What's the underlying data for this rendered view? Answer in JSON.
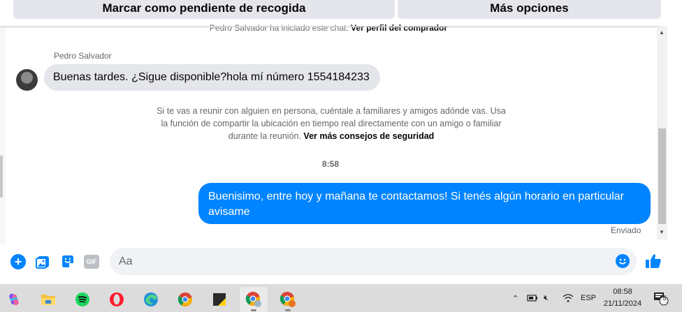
{
  "actions": {
    "mark_pending": "Marcar como pendiente de recogida",
    "more_options": "Más opciones"
  },
  "system": {
    "started_text": "Pedro Salvador ha iniciado este chat.",
    "profile_link": "Ver perfil del comprador"
  },
  "conversation": {
    "sender_name": "Pedro Salvador",
    "incoming_message": "Buenas tardes. ¿Sigue disponible?hola mí número 1554184233",
    "safety_text": "Si te vas a reunir con alguien en persona, cuéntale a familiares y amigos adónde vas. Usa la función de compartir la ubicación en tiempo real directamente con un amigo o familiar durante la reunión.",
    "safety_link": "Ver más consejos de seguridad",
    "time": "8:58",
    "outgoing_message": "Buenisimo, entre hoy y mañana te contactamos! Si tenés algún horario en particular avisame",
    "status": "Enviado"
  },
  "composer": {
    "placeholder": "Aa",
    "gif_label": "GIF"
  },
  "colors": {
    "accent": "#0084ff",
    "incoming_bubble": "#e4e6eb",
    "muted_text": "#65676b"
  },
  "taskbar": {
    "apps": [
      "copilot-icon",
      "file-explorer-icon",
      "spotify-icon",
      "opera-icon",
      "edge-icon",
      "chrome-icon",
      "sticky-notes-icon",
      "chrome-profile-icon",
      "chrome-alt-profile-icon"
    ],
    "language": "ESP",
    "time": "08:58",
    "date": "21/11/2024",
    "notification_count": "5"
  }
}
